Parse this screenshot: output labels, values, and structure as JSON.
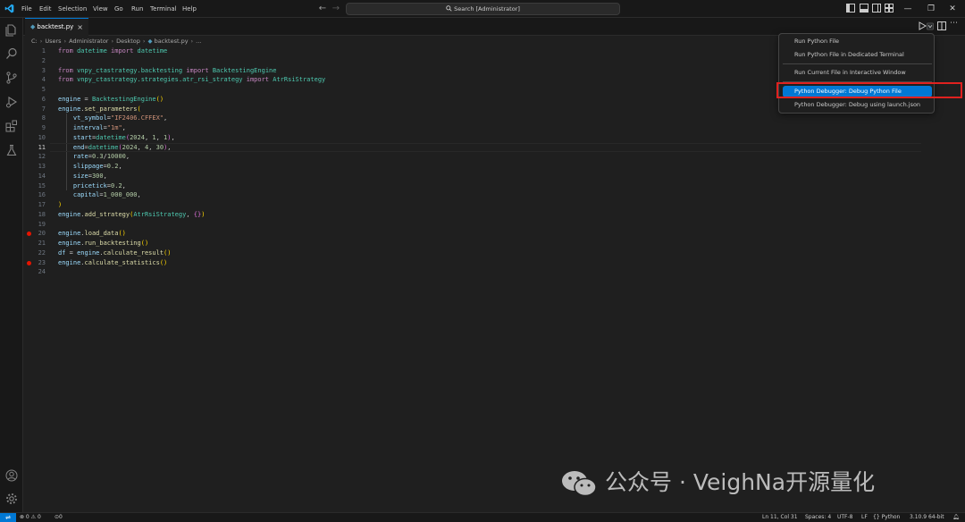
{
  "menubar": {
    "items": [
      "File",
      "Edit",
      "Selection",
      "View",
      "Go",
      "Run",
      "Terminal",
      "Help"
    ]
  },
  "search": {
    "text": "Search [Administrator]"
  },
  "tab": {
    "filename": "backtest.py",
    "close": "×"
  },
  "breadcrumb": {
    "parts": [
      "C:",
      "Users",
      "Administrator",
      "Desktop",
      "backtest.py",
      "..."
    ]
  },
  "editor": {
    "current_line": 11,
    "breakpoints": [
      20,
      23
    ],
    "lines": [
      [
        [
          "k",
          "from "
        ],
        [
          "m",
          "datetime "
        ],
        [
          "k",
          "import "
        ],
        [
          "m",
          "datetime"
        ]
      ],
      [],
      [
        [
          "k",
          "from "
        ],
        [
          "m",
          "vnpy_ctastrategy.backtesting "
        ],
        [
          "k",
          "import "
        ],
        [
          "m",
          "BacktestingEngine"
        ]
      ],
      [
        [
          "k",
          "from "
        ],
        [
          "m",
          "vnpy_ctastrategy.strategies.atr_rsi_strategy "
        ],
        [
          "k",
          "import "
        ],
        [
          "m",
          "AtrRsiStrategy"
        ]
      ],
      [],
      [
        [
          "v",
          "engine "
        ],
        [
          "w",
          "= "
        ],
        [
          "m",
          "BacktestingEngine"
        ],
        [
          "b1",
          "()"
        ]
      ],
      [
        [
          "v",
          "engine"
        ],
        [
          "w",
          "."
        ],
        [
          "f",
          "set_parameters"
        ],
        [
          "b1",
          "("
        ]
      ],
      [
        [
          "w",
          "    "
        ],
        [
          "v",
          "vt_symbol"
        ],
        [
          "w",
          "="
        ],
        [
          "s",
          "\"IF2406.CFFEX\""
        ],
        [
          "w",
          ","
        ]
      ],
      [
        [
          "w",
          "    "
        ],
        [
          "v",
          "interval"
        ],
        [
          "w",
          "="
        ],
        [
          "s",
          "\"1m\""
        ],
        [
          "w",
          ","
        ]
      ],
      [
        [
          "w",
          "    "
        ],
        [
          "v",
          "start"
        ],
        [
          "w",
          "="
        ],
        [
          "m",
          "datetime"
        ],
        [
          "b2",
          "("
        ],
        [
          "n",
          "2024"
        ],
        [
          "w",
          ", "
        ],
        [
          "n",
          "1"
        ],
        [
          "w",
          ", "
        ],
        [
          "n",
          "1"
        ],
        [
          "b2",
          ")"
        ],
        [
          "w",
          ","
        ]
      ],
      [
        [
          "w",
          "    "
        ],
        [
          "v",
          "end"
        ],
        [
          "w",
          "="
        ],
        [
          "m",
          "datetime"
        ],
        [
          "b2",
          "("
        ],
        [
          "n",
          "2024"
        ],
        [
          "w",
          ", "
        ],
        [
          "n",
          "4"
        ],
        [
          "w",
          ", "
        ],
        [
          "n",
          "30"
        ],
        [
          "b2",
          ")"
        ],
        [
          "w",
          ","
        ]
      ],
      [
        [
          "w",
          "    "
        ],
        [
          "v",
          "rate"
        ],
        [
          "w",
          "="
        ],
        [
          "n",
          "0.3"
        ],
        [
          "w",
          "/"
        ],
        [
          "n",
          "10000"
        ],
        [
          "w",
          ","
        ]
      ],
      [
        [
          "w",
          "    "
        ],
        [
          "v",
          "slippage"
        ],
        [
          "w",
          "="
        ],
        [
          "n",
          "0.2"
        ],
        [
          "w",
          ","
        ]
      ],
      [
        [
          "w",
          "    "
        ],
        [
          "v",
          "size"
        ],
        [
          "w",
          "="
        ],
        [
          "n",
          "300"
        ],
        [
          "w",
          ","
        ]
      ],
      [
        [
          "w",
          "    "
        ],
        [
          "v",
          "pricetick"
        ],
        [
          "w",
          "="
        ],
        [
          "n",
          "0.2"
        ],
        [
          "w",
          ","
        ]
      ],
      [
        [
          "w",
          "    "
        ],
        [
          "v",
          "capital"
        ],
        [
          "w",
          "="
        ],
        [
          "n",
          "1_000_000"
        ],
        [
          "w",
          ","
        ]
      ],
      [
        [
          "b1",
          ")"
        ]
      ],
      [
        [
          "v",
          "engine"
        ],
        [
          "w",
          "."
        ],
        [
          "f",
          "add_strategy"
        ],
        [
          "b1",
          "("
        ],
        [
          "m",
          "AtrRsiStrategy"
        ],
        [
          "w",
          ", "
        ],
        [
          "b2",
          "{}"
        ],
        [
          "b1",
          ")"
        ]
      ],
      [],
      [
        [
          "v",
          "engine"
        ],
        [
          "w",
          "."
        ],
        [
          "f",
          "load_data"
        ],
        [
          "b1",
          "()"
        ]
      ],
      [
        [
          "v",
          "engine"
        ],
        [
          "w",
          "."
        ],
        [
          "f",
          "run_backtesting"
        ],
        [
          "b1",
          "()"
        ]
      ],
      [
        [
          "v",
          "df "
        ],
        [
          "w",
          "= "
        ],
        [
          "v",
          "engine"
        ],
        [
          "w",
          "."
        ],
        [
          "f",
          "calculate_result"
        ],
        [
          "b1",
          "()"
        ]
      ],
      [
        [
          "v",
          "engine"
        ],
        [
          "w",
          "."
        ],
        [
          "f",
          "calculate_statistics"
        ],
        [
          "b1",
          "()"
        ]
      ],
      []
    ]
  },
  "run_menu": {
    "run_file": "Run Python File",
    "run_terminal": "Run Python File in Dedicated Terminal",
    "run_interactive": "Run Current File in Interactive Window",
    "debug_file": "Python Debugger: Debug Python File",
    "debug_launch": "Python Debugger: Debug using launch.json"
  },
  "statusbar": {
    "problems": "⊗ 0 ⚠ 0",
    "ports": "0",
    "position": "Ln 11, Col 31",
    "spaces": "Spaces: 4",
    "encoding": "UTF-8",
    "eol": "LF",
    "language": "Python",
    "interpreter": "3.10.9 64-bit"
  },
  "watermark": {
    "text": "公众号 · VeighNa开源量化"
  },
  "colors": {
    "accent": "#0078d4",
    "breakpoint": "#e51400",
    "highlight": "#e0211f"
  }
}
